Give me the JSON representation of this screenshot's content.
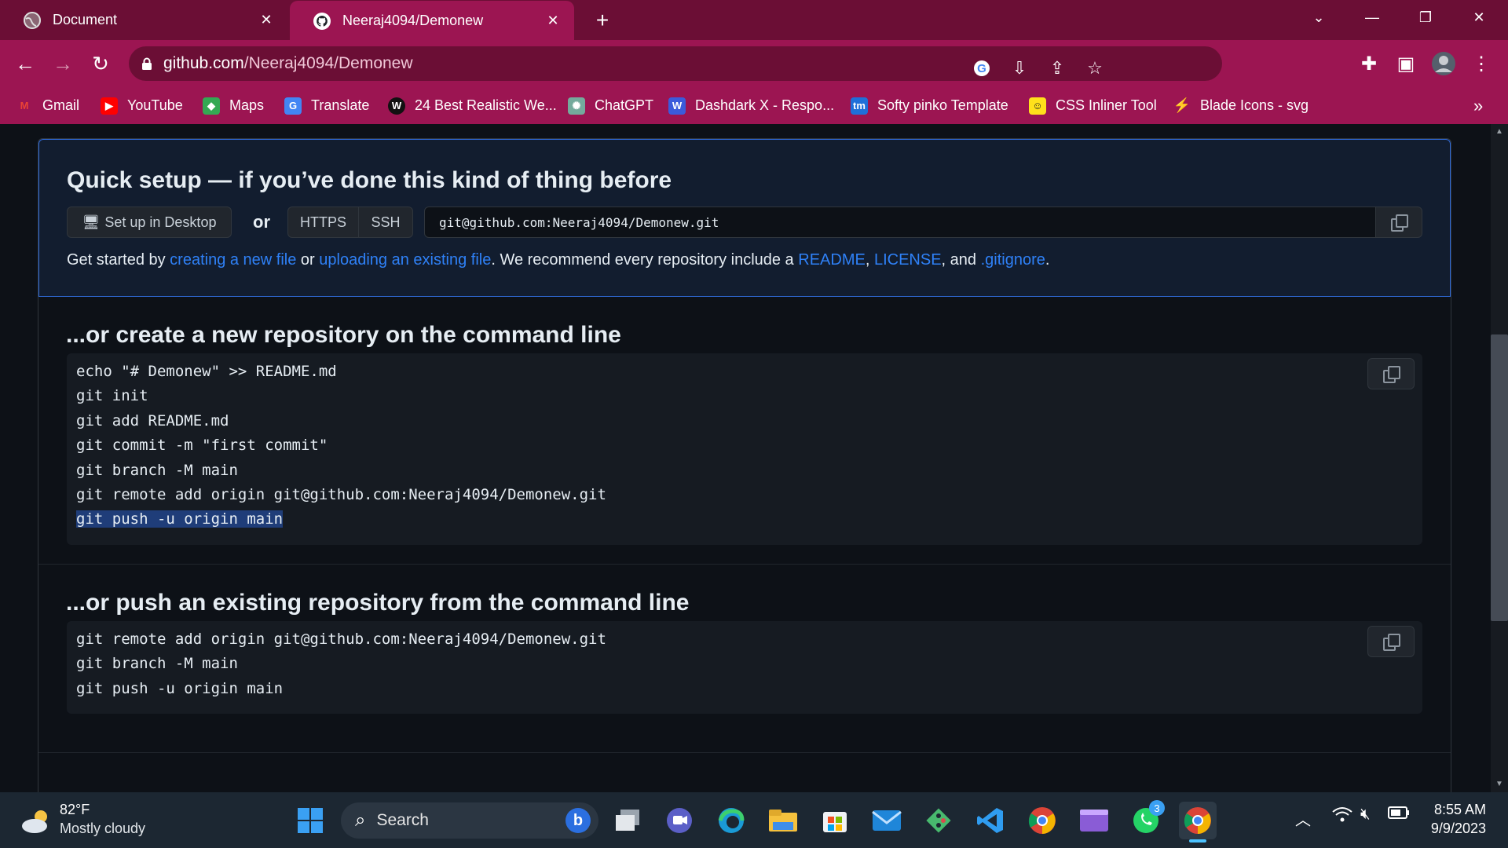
{
  "browser": {
    "tabs": [
      {
        "title": "Document",
        "icon": "globe-icon"
      },
      {
        "title": "Neeraj4094/Demonew",
        "icon": "github-icon",
        "active": true
      }
    ],
    "url_host": "github.com",
    "url_path": "/Neeraj4094/Demonew",
    "bookmarks": [
      {
        "label": "Gmail",
        "icon": "gmail-icon",
        "color": "#ea4335"
      },
      {
        "label": "YouTube",
        "icon": "youtube-icon",
        "color": "#ff0000"
      },
      {
        "label": "Maps",
        "icon": "maps-icon",
        "color": "#34a853"
      },
      {
        "label": "Translate",
        "icon": "translate-icon",
        "color": "#4285f4"
      },
      {
        "label": "24 Best Realistic We...",
        "icon": "w-icon",
        "color": "#222222"
      },
      {
        "label": "ChatGPT",
        "icon": "chatgpt-icon",
        "color": "#74aa9c"
      },
      {
        "label": "Dashdark X - Respo...",
        "icon": "w-blue-icon",
        "color": "#3b5bdb"
      },
      {
        "label": "Softy pinko Template",
        "icon": "tm-icon",
        "color": "#1e6fd9"
      },
      {
        "label": "CSS Inliner Tool",
        "icon": "mailchimp-icon",
        "color": "#ffe01b"
      },
      {
        "label": "Blade Icons - svg",
        "icon": "blade-icon",
        "color": "#f05340"
      }
    ],
    "more_bookmarks": "»"
  },
  "quick_setup": {
    "title": "Quick setup — if you’ve done this kind of thing before",
    "desktop_button": "Set up in Desktop",
    "or": "or",
    "https": "HTTPS",
    "ssh": "SSH",
    "clone_url": "git@github.com:Neeraj4094/Demonew.git",
    "get_started_prefix": "Get started by ",
    "link_new_file": "creating a new file",
    "or_text": " or ",
    "link_upload": "uploading an existing file",
    "recommend_text": ". We recommend every repository include a ",
    "link_readme": "README",
    "comma1": ", ",
    "link_license": "LICENSE",
    "and_text": ", and ",
    "link_gitignore": ".gitignore",
    "period": "."
  },
  "new_repo": {
    "title": "...or create a new repository on the command line",
    "lines": [
      "echo \"# Demonew\" >> README.md",
      "git init",
      "git add README.md",
      "git commit -m \"first commit\"",
      "git branch -M main",
      "git remote add origin git@github.com:Neeraj4094/Demonew.git",
      "git push -u origin main"
    ]
  },
  "push_repo": {
    "title": "...or push an existing repository from the command line",
    "lines": [
      "git remote add origin git@github.com:Neeraj4094/Demonew.git",
      "git branch -M main",
      "git push -u origin main"
    ]
  },
  "taskbar": {
    "temp": "82°F",
    "weather": "Mostly cloudy",
    "search_placeholder": "Search",
    "whatsapp_badge": "3",
    "time": "8:55 AM",
    "date": "9/9/2023"
  }
}
